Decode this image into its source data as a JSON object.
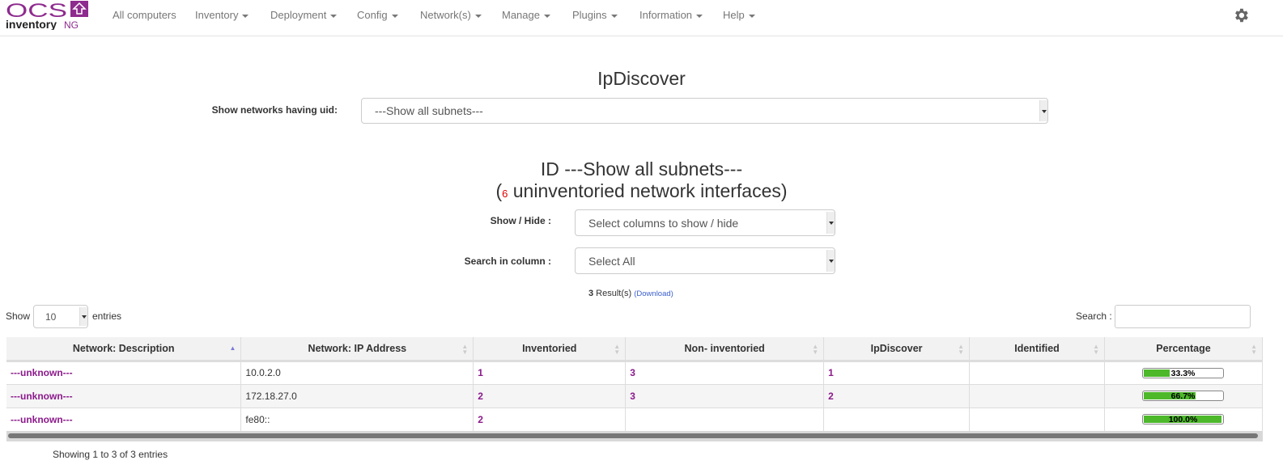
{
  "nav": {
    "logo": "OCS inventory NG",
    "items": [
      {
        "label": "All computers",
        "dropdown": false
      },
      {
        "label": "Inventory",
        "dropdown": true
      },
      {
        "label": "Deployment",
        "dropdown": true
      },
      {
        "label": "Config",
        "dropdown": true
      },
      {
        "label": "Network(s)",
        "dropdown": true
      },
      {
        "label": "Manage",
        "dropdown": true
      },
      {
        "label": "Plugins",
        "dropdown": true
      },
      {
        "label": "Information",
        "dropdown": true
      },
      {
        "label": "Help",
        "dropdown": true
      }
    ],
    "settings_icon": "gear-icon"
  },
  "page": {
    "title": "IpDiscover",
    "uid_label": "Show networks having uid:",
    "uid_value": "---Show all subnets---",
    "sub_title": "ID ---Show all subnets---",
    "count": "6",
    "count_text": " uninventoried network interfaces)",
    "paren_open": "(",
    "show_hide_label": "Show / Hide :",
    "show_hide_value": "Select columns to show / hide",
    "search_col_label": "Search in column :",
    "search_col_value": "Select All",
    "results_count": "3",
    "results_text": " Result(s) ",
    "download": "(Download)"
  },
  "table": {
    "show": "Show",
    "length": "10",
    "entries": "entries",
    "search_label": "Search :",
    "search_value": "",
    "columns": [
      "Network: Description",
      "Network: IP Address",
      "Inventoried",
      "Non- inventoried",
      "IpDiscover",
      "Identified",
      "Percentage"
    ],
    "rows": [
      {
        "desc": "---unknown---",
        "ip": "10.0.2.0",
        "inv": "1",
        "noninv": "3",
        "ipd": "1",
        "ident": "",
        "pct": 33.3,
        "pct_label": "33.3%"
      },
      {
        "desc": "---unknown---",
        "ip": "172.18.27.0",
        "inv": "2",
        "noninv": "3",
        "ipd": "2",
        "ident": "",
        "pct": 66.7,
        "pct_label": "66.7%"
      },
      {
        "desc": "---unknown---",
        "ip": "fe80::",
        "inv": "2",
        "noninv": "",
        "ipd": "",
        "ident": "",
        "pct": 100,
        "pct_label": "100.0%"
      }
    ],
    "info": "Showing 1 to 3 of 3 entries"
  },
  "colors": {
    "brand": "#8e2b8e",
    "link": "#8b1a8b",
    "progress": "#4cb82a",
    "count": "#e00000"
  }
}
